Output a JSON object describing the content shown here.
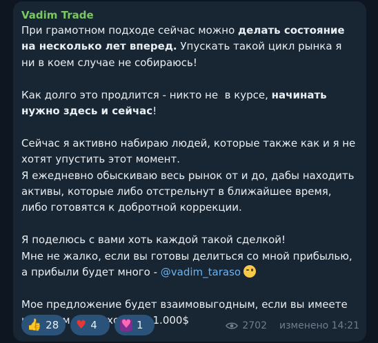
{
  "message": {
    "sender": "Vadim Trade",
    "paragraphs": {
      "p1_a": "При грамотном подходе сейчас можно ",
      "p1_b": "делать состояние на несколько лет вперед.",
      "p1_c": " Упускать такой цикл рынка я ни в коем случае не собираюсь!",
      "p2_a": "Как долго это продлится - никто не  в курсе, ",
      "p2_b": "начинать нужно здесь и сейчас",
      "p2_c": "!",
      "p3": "Сейчас я активно набираю людей, которые также как и я не хотят упустить этот момент.\nЯ ежедневно обыскиваю весь рынок от и до, дабы находить активы, которые либо отстрельнут в ближайшее время, либо готовятся к добротной коррекции.",
      "p4_a": "Я поделюсь с вами хоть каждой такой сделкой!\nМне не жалко, если вы готовы делиться со мной прибылью, а прибыли будет много - ",
      "p4_mention": "@vadim_taraso",
      "p5": "Мое предложение будет взаимовыгодным, если вы имеете на своем счету хотя бы 1.000$"
    }
  },
  "reactions": [
    {
      "icon": "thumbs-up",
      "count": "28"
    },
    {
      "icon": "red-heart",
      "count": "4"
    },
    {
      "icon": "heart-with-ribbon",
      "count": "1"
    }
  ],
  "meta": {
    "views": "2702",
    "edited_time": "изменено 14:21"
  },
  "colors": {
    "background": "#0e1621",
    "bubble": "#182533",
    "sender": "#7bc862",
    "link": "#6ab3f3",
    "reaction": "#2b5278"
  }
}
